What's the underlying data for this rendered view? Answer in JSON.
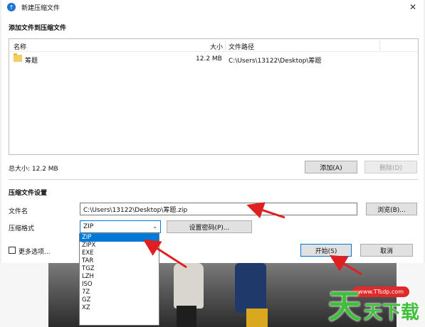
{
  "window": {
    "title": "新建压缩文件",
    "close_glyph": "✕",
    "app_icon_glyph": "↑"
  },
  "add_files": {
    "section_title": "添加文件到压缩文件",
    "columns": {
      "name": "名称",
      "size": "大小",
      "path": "文件路径"
    },
    "rows": [
      {
        "name": "筹题",
        "size": "12.2 MB",
        "path": "C:\\Users\\13122\\Desktop\\筹题"
      }
    ],
    "total_size": "总大小: 12.2 MB",
    "add_button": "添加(A)",
    "delete_button": "删除(D)"
  },
  "settings": {
    "section_title": "压缩文件设置",
    "filename_label": "文件名",
    "filename_value": "C:\\Users\\13122\\Desktop\\筹题.zip",
    "browse_button": "浏览(B)...",
    "format_label": "压缩格式",
    "format_value": "ZIP",
    "format_arrow": "⌄",
    "password_button": "设置密码(P)...",
    "format_options": [
      "ZIP",
      "ZIPX",
      "EXE",
      "TAR",
      "TGZ",
      "LZH",
      "ISO",
      "7Z",
      "GZ",
      "XZ"
    ],
    "selected_option": "ZIP"
  },
  "footer": {
    "more_options": "更多选项...",
    "start_button": "开始(S)",
    "cancel_button": "取消"
  },
  "watermark": {
    "big_char": "天",
    "small_chars": "天下载",
    "url": "www.TTsdp.com"
  },
  "colors": {
    "accent": "#0078d7",
    "arrow": "#e02020",
    "watermark": "#3fbf3a"
  }
}
